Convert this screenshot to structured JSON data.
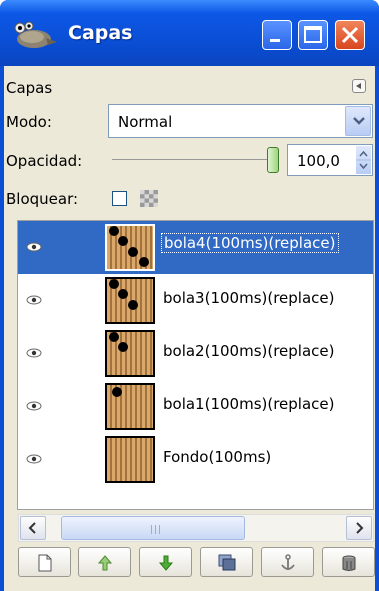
{
  "window": {
    "title": "Capas"
  },
  "panel": {
    "label": "Capas",
    "mode_label": "Modo:",
    "mode_value": "Normal",
    "opacity_label": "Opacidad:",
    "opacity_value": "100,0",
    "opacity_level": 1.0,
    "lock_label": "Bloquear:",
    "lock_checked": false
  },
  "layers": [
    {
      "name": "bola4(100ms)(replace)",
      "selected": true,
      "visible": true
    },
    {
      "name": "bola3(100ms)(replace)",
      "selected": false,
      "visible": true
    },
    {
      "name": "bola2(100ms)(replace)",
      "selected": false,
      "visible": true
    },
    {
      "name": "bola1(100ms)(replace)",
      "selected": false,
      "visible": true
    },
    {
      "name": "Fondo(100ms)",
      "selected": false,
      "visible": true
    }
  ],
  "toolbar": [
    "new-layer-icon",
    "raise-layer-icon",
    "lower-layer-icon",
    "duplicate-layer-icon",
    "anchor-layer-icon",
    "delete-layer-icon"
  ],
  "colors": {
    "titlebar": "#0a4fd6",
    "selection": "#316ac5",
    "panel": "#ece9d8"
  }
}
